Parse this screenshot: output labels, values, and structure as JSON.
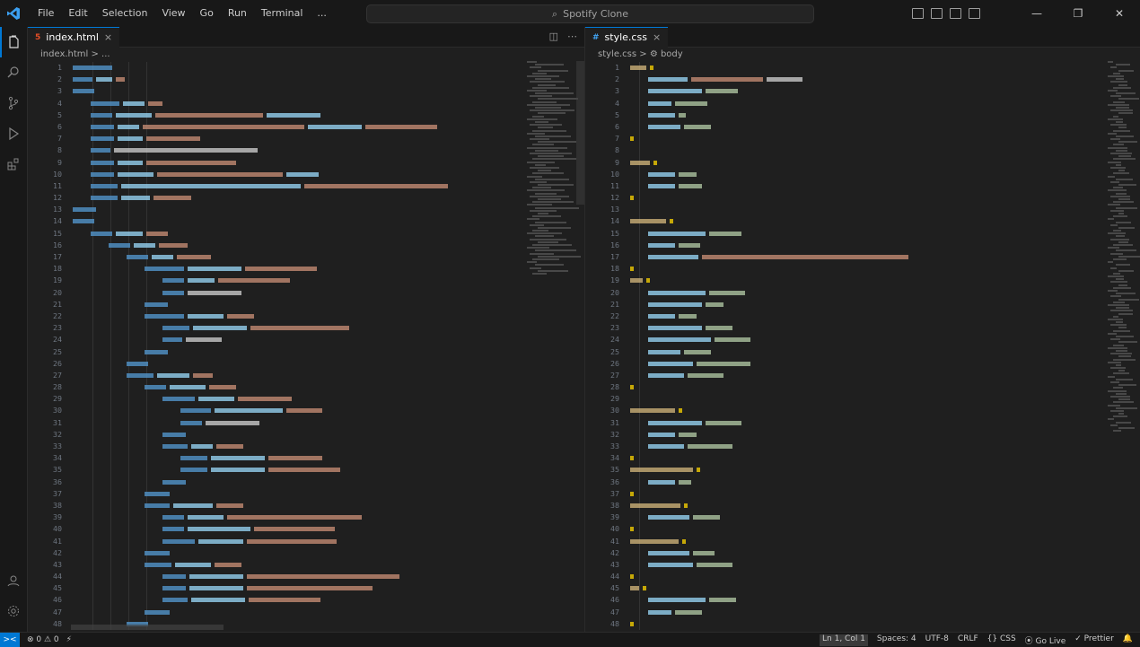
{
  "titlebar": {
    "menus": [
      "File",
      "Edit",
      "Selection",
      "View",
      "Go",
      "Run",
      "Terminal",
      "..."
    ],
    "back": "←",
    "forward": "→",
    "search_text": "Spotify Clone",
    "controls": {
      "minimize": "—",
      "restore": "❐",
      "close": "✕"
    }
  },
  "activity_bar": {
    "items": [
      "explorer-icon",
      "search-icon",
      "source-control-icon",
      "run-debug-icon",
      "extensions-icon"
    ],
    "bottom": [
      "account-icon",
      "settings-gear-icon"
    ]
  },
  "left_editor": {
    "tab": {
      "icon": "5",
      "icon_color": "#e44d26",
      "label": "index.html",
      "close": "×"
    },
    "breadcrumb": "index.html > ...",
    "actions": [
      "◫",
      "⋯"
    ]
  },
  "right_editor": {
    "tab": {
      "icon": "#",
      "icon_color": "#42a5f5",
      "label": "style.css",
      "close": "×"
    },
    "breadcrumb": "style.css > ⚙ body"
  },
  "statusbar": {
    "remote": "><",
    "left": [
      "⊗ 0 ⚠ 0",
      "⚡"
    ],
    "right": [
      "Ln 1, Col 1",
      "Spaces: 4",
      "UTF-8",
      "CRLF",
      "{} CSS",
      "⦿ Go Live",
      "✓ Prettier",
      "🔔"
    ]
  },
  "colors": {
    "accent": "#0078d4",
    "background": "#1f1f1f",
    "titlebar": "#181818"
  }
}
